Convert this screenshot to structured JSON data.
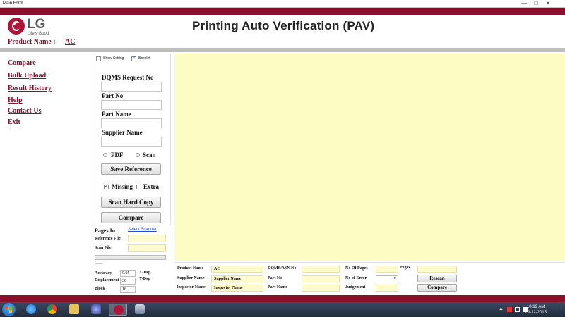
{
  "window": {
    "title": "Main Form",
    "min_glyph": "—",
    "max_glyph": "□",
    "close_glyph": "✕"
  },
  "header": {
    "logo_text": "LG",
    "logo_tagline": "Life's Good",
    "product_label": "Product Name :-",
    "product_value": "AC",
    "app_title": "Printing Auto Verification (PAV)"
  },
  "nav": {
    "items": [
      {
        "label": "Compare"
      },
      {
        "label": "Bulk Upload"
      },
      {
        "label": "Result History"
      },
      {
        "label": "Help"
      },
      {
        "label": "Contact Us"
      },
      {
        "label": "Exit"
      }
    ]
  },
  "panel": {
    "show_setting": {
      "label": "Show Setting",
      "checked": false
    },
    "booklet": {
      "label": "Booklet",
      "checked": true
    },
    "fields": [
      {
        "label": "DQMS Request No",
        "value": ""
      },
      {
        "label": "Part No",
        "value": ""
      },
      {
        "label": "Part Name",
        "value": ""
      },
      {
        "label": "Supplier Name",
        "value": ""
      }
    ],
    "radio_pdf": "PDF",
    "radio_scan": "Scan",
    "save_reference": "Save Reference",
    "missing": {
      "label": "Missing",
      "checked": true
    },
    "extra": {
      "label": "Extra",
      "checked": false
    },
    "scan_hard_copy": "Scan Hard Copy",
    "compare": "Compare"
  },
  "lower_left": {
    "pages_in": "Pages In",
    "select_scanner": "Select Scanner",
    "reference_file": "Reference File",
    "scan_file": "Scan File",
    "dashes": "-----",
    "accuracy_label": "Accuracy",
    "accuracy_value": "0.95",
    "displacement_label": "Displacement",
    "displacement_value": "30",
    "block_label": "Block",
    "block_value": "16",
    "xdsp_label": "X-Dsp",
    "ydsp_label": "Y-Dsp"
  },
  "bottom_form": {
    "product_name_label": "Product Name",
    "product_name_value": "AC",
    "supplier_name_label": "Supplier Name",
    "supplier_name_value": "Supplier Name",
    "inspector_name_label": "Inspector Name",
    "inspector_name_value": "Inspector Name",
    "dqms_label": "DQMS/ASN No",
    "part_no_label": "Part No",
    "part_name_label": "Part Name",
    "no_of_pages_label": "No Of Pages",
    "no_of_error_label": "No of Error",
    "judgement_label": "Judgement",
    "pages_label": "Pages",
    "rescan": "Rescan",
    "compare": "Compare"
  },
  "taskbar": {
    "tray_caret": "▲",
    "clock_time": "10:19 AM",
    "clock_date": "29-12-2015"
  },
  "colors": {
    "brand": "#8a0f2a",
    "viewer": "#fdfcc3",
    "field_yellow": "#fffbcc"
  }
}
